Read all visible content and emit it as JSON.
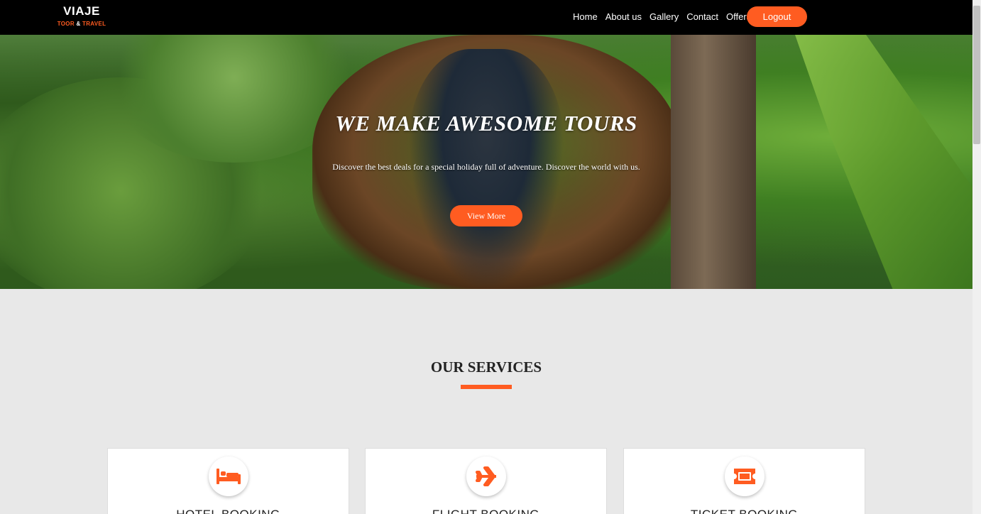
{
  "logo": {
    "main": "VIAJE",
    "sub_left": "TOOR",
    "sub_amp": "&",
    "sub_right": "TRAVEL"
  },
  "nav": {
    "links": [
      "Home",
      "About us",
      "Gallery",
      "Contact",
      "Offers"
    ],
    "logout_label": "Logout"
  },
  "hero": {
    "title": "WE MAKE AWESOME TOURS",
    "subtitle": "Discover the best deals for a special holiday full of adventure. Discover the world with us.",
    "button_label": "View More"
  },
  "services": {
    "title": "OUR SERVICES",
    "cards": [
      {
        "title": "HOTEL BOOKING",
        "icon": "bed-icon"
      },
      {
        "title": "FLIGHT BOOKING",
        "icon": "airplane-icon"
      },
      {
        "title": "TICKET BOOKING",
        "icon": "ticket-icon"
      }
    ]
  },
  "colors": {
    "accent": "#ff5c21",
    "navbar": "#000000",
    "background": "#e8e8e8"
  }
}
